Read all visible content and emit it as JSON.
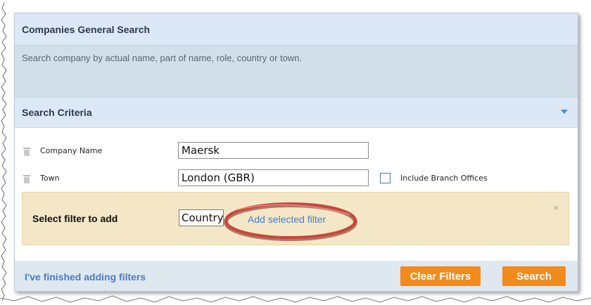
{
  "header": {
    "title": "Companies General Search"
  },
  "description": "Search company by actual name, part of name, role, country or town.",
  "criteria": {
    "title": "Search Criteria"
  },
  "fields": [
    {
      "label": "Company Name",
      "value": "Maersk"
    },
    {
      "label": "Town",
      "value": "London (GBR)"
    }
  ],
  "branch_offices": {
    "label": "Include Branch Offices",
    "checked": false
  },
  "filter": {
    "label": "Select filter to add",
    "selected": "Country",
    "add_link": "Add selected filter",
    "close": "×"
  },
  "footer": {
    "finished_link": "I've finished adding filters",
    "clear_button": "Clear Filters",
    "search_button": "Search"
  },
  "colors": {
    "header_bg": "#dce8f5",
    "accent_orange": "#f28a1c",
    "link_blue": "#4a7bc8",
    "filter_bg": "#f4e7c7",
    "highlight_red": "#c0392b"
  }
}
